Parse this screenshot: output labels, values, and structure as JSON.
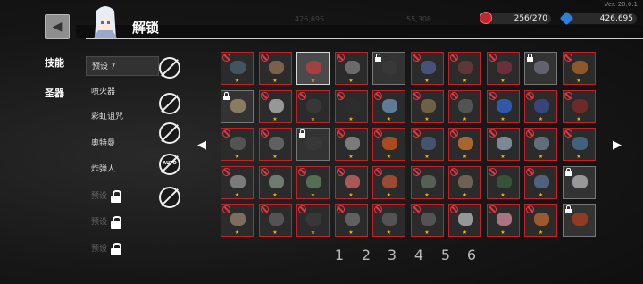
{
  "app": {
    "version": "Ver. 20.0.1",
    "title": "解锁"
  },
  "resources": {
    "relic_count": "256/270",
    "gems": "426,695"
  },
  "background_text": {
    "left_value": "426,695",
    "mid_value": "55,308"
  },
  "side_tabs": [
    "技能",
    "圣器"
  ],
  "presets": [
    {
      "label": "预设 7",
      "locked": false,
      "selected": true
    },
    {
      "label": "喷火器",
      "locked": false,
      "selected": false
    },
    {
      "label": "彩虹诅咒",
      "locked": false,
      "selected": false
    },
    {
      "label": "奥特曼",
      "locked": false,
      "selected": false
    },
    {
      "label": "炸弹人",
      "locked": false,
      "selected": false
    },
    {
      "label": "预设",
      "locked": true,
      "selected": false
    },
    {
      "label": "预设",
      "locked": true,
      "selected": false
    },
    {
      "label": "预设",
      "locked": true,
      "selected": false
    }
  ],
  "right_icons": [
    {
      "name": "search-disable-icon",
      "tag": ""
    },
    {
      "name": "hand-disable-icon",
      "tag": ""
    },
    {
      "name": "ring-disable-icon",
      "tag": ""
    },
    {
      "name": "auto-disable-icon",
      "tag": "AUTO"
    },
    {
      "name": "cycle-disable-icon",
      "tag": ""
    }
  ],
  "nav": {
    "left_arrow": "◀",
    "right_arrow": "▶"
  },
  "column_numbers": [
    "1",
    "2",
    "3",
    "4",
    "5",
    "6"
  ],
  "grid": {
    "rows": [
      [
        "banned",
        "banned",
        "selected",
        "banned",
        "locked",
        "banned",
        "banned",
        "banned",
        "locked",
        "banned"
      ],
      [
        "locked",
        "banned",
        "banned",
        "banned",
        "banned",
        "banned",
        "banned",
        "banned",
        "banned",
        "banned"
      ],
      [
        "banned",
        "banned",
        "locked",
        "banned",
        "banned",
        "banned",
        "banned",
        "banned",
        "banned",
        "banned"
      ],
      [
        "banned",
        "banned",
        "banned",
        "banned",
        "banned",
        "banned",
        "banned",
        "banned",
        "banned",
        "locked"
      ],
      [
        "banned",
        "banned",
        "banned",
        "banned",
        "banned",
        "banned",
        "banned",
        "banned",
        "banned",
        "locked"
      ]
    ],
    "item_colors": [
      [
        "#4a5a6a",
        "#8a6a50",
        "#b04040",
        "#777777",
        "#3a3a3a",
        "#4a5a8a",
        "#6a3a3a",
        "#7a3040",
        "#6a6a7a",
        "#a0602a"
      ],
      [
        "#9a8a6a",
        "#aaaaaa",
        "#3a3a3a",
        "#2e2e2e",
        "#6a8aa8",
        "#7a6a4a",
        "#5a5a5a",
        "#3060c0",
        "#3a4a8a",
        "#7a2a2a"
      ],
      [
        "#5a5a5a",
        "#6a6a6a",
        "#3a3a3a",
        "#8a8a8a",
        "#c05020",
        "#4a5a7a",
        "#c07030",
        "#8a9aaa",
        "#6a7a8a",
        "#4a6a8a"
      ],
      [
        "#8a8a8a",
        "#7a8a7a",
        "#5a7a5a",
        "#c06060",
        "#b05030",
        "#5a6a5a",
        "#7a6a5a",
        "#3a5a3a",
        "#5a6a8a",
        "#aaaaaa"
      ],
      [
        "#8a7a6a",
        "#5a5a5a",
        "#3a3a3a",
        "#6a6a6a",
        "#5a5a5a",
        "#5a5a5a",
        "#aaaaaa",
        "#c08090",
        "#b06030",
        "#a04020"
      ]
    ]
  }
}
